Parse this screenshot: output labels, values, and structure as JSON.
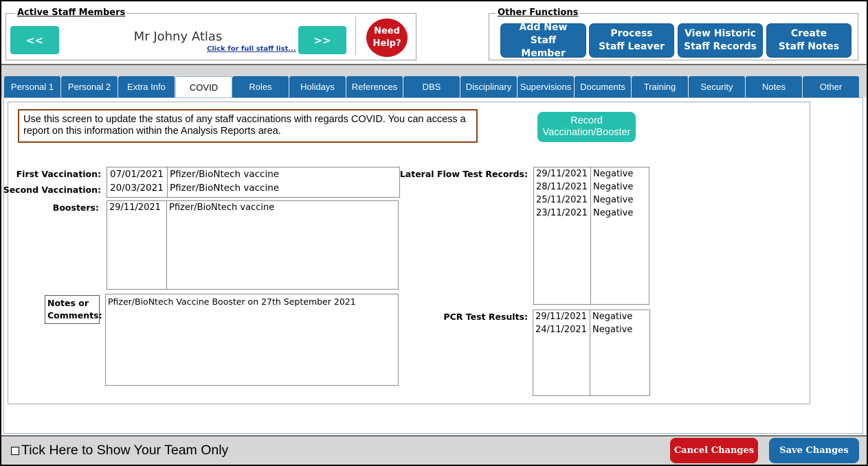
{
  "staff": {
    "group_title": "Active Staff Members",
    "prev_label": "<<",
    "next_label": ">>",
    "name": "Mr Johny Atlas",
    "full_list_link": "Click for full staff list...",
    "help_label": "Need Help?"
  },
  "other_functions": {
    "group_title": "Other Functions",
    "buttons": [
      {
        "label": "Add New Staff Member"
      },
      {
        "label": "Process Staff Leaver"
      },
      {
        "label": "View Historic Staff Records"
      },
      {
        "label": "Create Staff Notes"
      }
    ]
  },
  "tabs": [
    {
      "label": "Personal 1"
    },
    {
      "label": "Personal 2"
    },
    {
      "label": "Extra Info"
    },
    {
      "label": "COVID",
      "active": true
    },
    {
      "label": "Roles"
    },
    {
      "label": "Holidays"
    },
    {
      "label": "References"
    },
    {
      "label": "DBS"
    },
    {
      "label": "Disciplinary"
    },
    {
      "label": "Supervisions"
    },
    {
      "label": "Documents"
    },
    {
      "label": "Training"
    },
    {
      "label": "Security"
    },
    {
      "label": "Notes"
    },
    {
      "label": "Other"
    }
  ],
  "covid": {
    "info_text": "Use this screen to update the status of any staff vaccinations with regards COVID.  You can access a report on this information within the Analysis Reports area.",
    "record_button": "Record Vaccination/Booster",
    "first_vaccination_label": "First Vaccination:",
    "second_vaccination_label": "Second Vaccination:",
    "vaccinations": [
      {
        "date": "07/01/2021",
        "vaccine": "Pfizer/BioNtech vaccine"
      },
      {
        "date": "20/03/2021",
        "vaccine": "Pfizer/BioNtech vaccine"
      }
    ],
    "boosters_label": "Boosters:",
    "boosters": [
      {
        "date": "29/11/2021",
        "vaccine": "Pfizer/BioNtech vaccine"
      }
    ],
    "notes_label_1": "Notes or",
    "notes_label_2": "Comments:",
    "notes_value": "Pfizer/BioNtech Vaccine Booster on 27th September 2021",
    "lft_label": "Lateral Flow Test Records:",
    "lft_records": [
      {
        "date": "29/11/2021",
        "result": "Negative"
      },
      {
        "date": "28/11/2021",
        "result": "Negative"
      },
      {
        "date": "25/11/2021",
        "result": "Negative"
      },
      {
        "date": "23/11/2021",
        "result": "Negative"
      }
    ],
    "pcr_label": "PCR Test Results:",
    "pcr_records": [
      {
        "date": "29/11/2021",
        "result": "Negative"
      },
      {
        "date": "24/11/2021",
        "result": "Negative"
      }
    ]
  },
  "footer": {
    "team_checkbox_label": "Tick Here to Show Your Team Only",
    "cancel_label": "Cancel Changes",
    "save_label": "Save Changes"
  },
  "colors": {
    "teal": "#26bfae",
    "blue": "#1c6aa8",
    "red": "#c8141c",
    "info_border": "#8b4513"
  }
}
